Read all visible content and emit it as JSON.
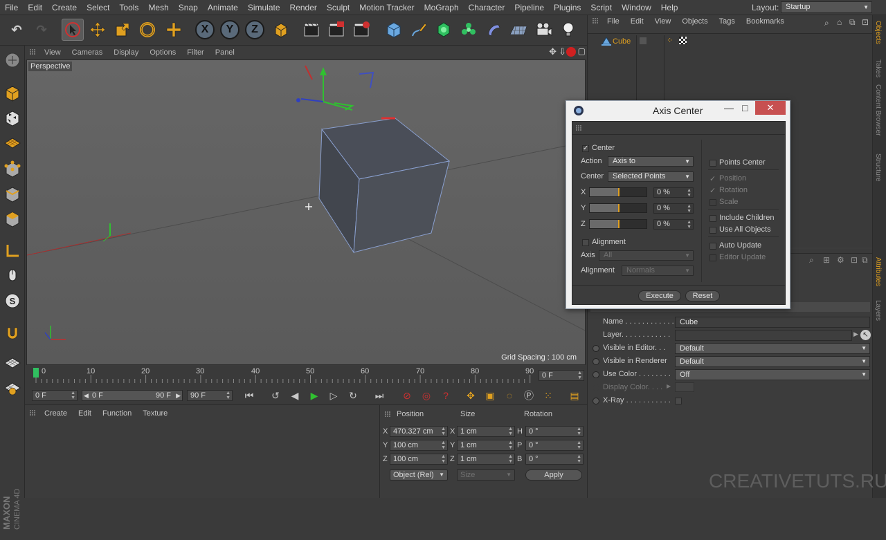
{
  "menubar": {
    "items": [
      "File",
      "Edit",
      "Create",
      "Select",
      "Tools",
      "Mesh",
      "Snap",
      "Animate",
      "Simulate",
      "Render",
      "Sculpt",
      "Motion Tracker",
      "MoGraph",
      "Character",
      "Pipeline",
      "Plugins",
      "Script",
      "Window",
      "Help"
    ],
    "layout_label": "Layout:",
    "layout_value": "Startup"
  },
  "toolbar": {
    "x_label": "X",
    "y_label": "Y",
    "z_label": "Z"
  },
  "viewport": {
    "menu": [
      "View",
      "Cameras",
      "Display",
      "Options",
      "Filter",
      "Panel"
    ],
    "label": "Perspective",
    "grid_spacing": "Grid Spacing : 100 cm"
  },
  "timeline": {
    "ticks": [
      "0",
      "10",
      "20",
      "30",
      "40",
      "50",
      "60",
      "70",
      "80",
      "90"
    ],
    "current_frame": "0 F",
    "start_field": "0 F",
    "range_start": "0 F",
    "range_end": "90 F",
    "end_field": "90 F"
  },
  "material_manager": {
    "menu": [
      "Create",
      "Edit",
      "Function",
      "Texture"
    ]
  },
  "coordinates": {
    "headers": {
      "position": "Position",
      "size": "Size",
      "rotation": "Rotation"
    },
    "rows": [
      {
        "axis": "X",
        "pos": "470.327 cm",
        "size_axis": "X",
        "size": "1 cm",
        "rot_axis": "H",
        "rot": "0 °"
      },
      {
        "axis": "Y",
        "pos": "100 cm",
        "size_axis": "Y",
        "size": "1 cm",
        "rot_axis": "P",
        "rot": "0 °"
      },
      {
        "axis": "Z",
        "pos": "100 cm",
        "size_axis": "Z",
        "size": "1 cm",
        "rot_axis": "B",
        "rot": "0 °"
      }
    ],
    "mode": "Object (Rel)",
    "size_mode": "Size",
    "apply": "Apply"
  },
  "object_manager": {
    "menu": [
      "File",
      "Edit",
      "View",
      "Objects",
      "Tags",
      "Bookmarks"
    ],
    "objects": [
      {
        "name": "Cube"
      }
    ]
  },
  "right_tabs": [
    "Objects",
    "Takes",
    "Content Browser",
    "Structure",
    "Attributes",
    "Layers"
  ],
  "attributes": {
    "rows": [
      {
        "label": "Name . . . . . . . . . . . .",
        "value": "Cube"
      },
      {
        "label": "Layer. . . . . . . . . . . .",
        "value": ""
      },
      {
        "label": "Visible in Editor. . .",
        "value": "Default"
      },
      {
        "label": "Visible in Renderer",
        "value": "Default"
      },
      {
        "label": "Use Color . . . . . . . .",
        "value": "Off"
      },
      {
        "label": "Display Color. . . .",
        "value": ""
      },
      {
        "label": "X-Ray . . . . . . . . . . .",
        "value": ""
      }
    ]
  },
  "dialog": {
    "title": "Axis Center",
    "center_label": "Center",
    "action_label": "Action",
    "action_value": "Axis to",
    "center_select_label": "Center",
    "center_value": "Selected Points",
    "sliders": [
      {
        "axis": "X",
        "value": "0 %",
        "fill": 0.5
      },
      {
        "axis": "Y",
        "value": "0 %",
        "fill": 0.5
      },
      {
        "axis": "Z",
        "value": "0 %",
        "fill": 0.5
      }
    ],
    "alignment_check": "Alignment",
    "axis_label": "Axis",
    "axis_value": "All",
    "alignment_label": "Alignment",
    "alignment_value": "Normals",
    "right": {
      "points_center": "Points Center",
      "position": "Position",
      "rotation": "Rotation",
      "scale": "Scale",
      "include_children": "Include Children",
      "use_all_objects": "Use All Objects",
      "auto_update": "Auto Update",
      "editor_update": "Editor Update"
    },
    "execute": "Execute",
    "reset": "Reset"
  },
  "branding": {
    "maxon": "MAXON",
    "cinema": "CINEMA 4D",
    "watermark": "CREATIVETUTS.RU"
  }
}
